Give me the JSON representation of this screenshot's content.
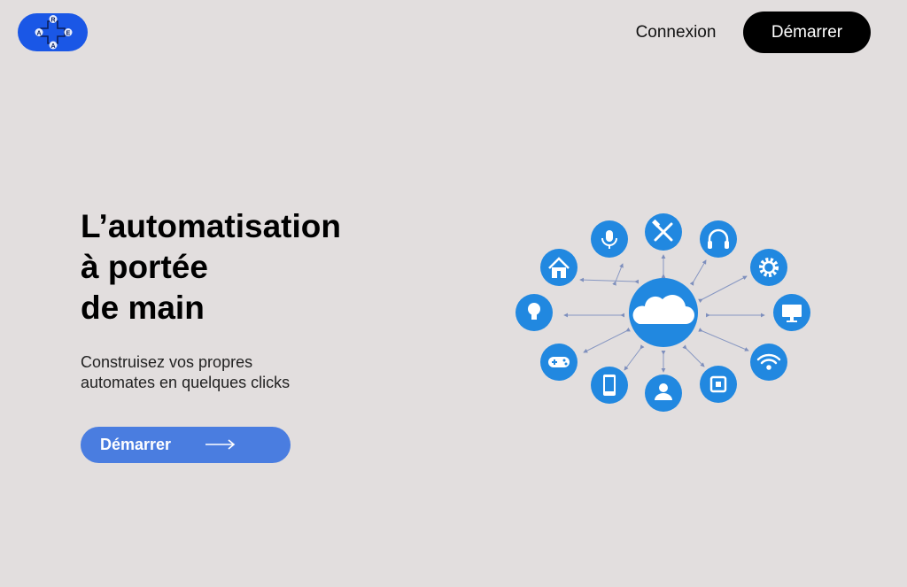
{
  "brand": {
    "logo_letters": [
      "R",
      "A",
      "E",
      "A"
    ],
    "logo_color": "#1a57e6"
  },
  "nav": {
    "login_label": "Connexion",
    "start_label": "Démarrer"
  },
  "hero": {
    "title_lines": [
      "L’automatisation",
      "à portée",
      "de main"
    ],
    "subtitle_lines": [
      "Construisez vos propres",
      "automates en quelques clicks"
    ],
    "cta_label": "Démarrer",
    "cta_arrow": "⟶",
    "accent_color": "#4a7de0"
  },
  "illustration": {
    "center_icon": "cloud-icon",
    "node_icons": [
      "microphone-icon",
      "tools-icon",
      "headphones-icon",
      "home-icon",
      "gear-icon",
      "lightbulb-icon",
      "monitor-icon",
      "gamepad-icon",
      "wifi-icon",
      "smartphone-icon",
      "user-icon",
      "chip-icon"
    ],
    "node_color": "#2188e0"
  }
}
